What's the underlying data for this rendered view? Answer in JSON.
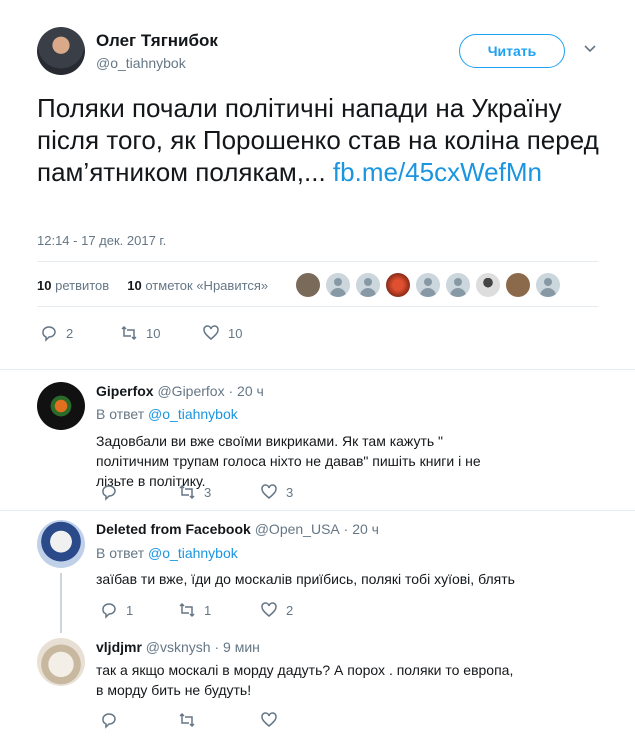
{
  "main_tweet": {
    "author_name": "Олег Тягнибок",
    "author_handle": "@o_tiahnybok",
    "follow_label": "Читать",
    "text": "Поляки почали політичні напади на Україну після того, як Порошенко став на коліна перед пам’ятником полякам,...",
    "link_text": "fb.me/45cxWefMn",
    "timestamp": "12:14 - 17 дек. 2017 г.",
    "retweets_count": "10",
    "retweets_label": "ретвитов",
    "likes_count": "10",
    "likes_label": "отметок «Нравится»",
    "reply_count": "2",
    "retweet_count_action": "10",
    "like_count_action": "10"
  },
  "replies": [
    {
      "name": "Giperfox",
      "handle": "@Giperfox",
      "time": "· 20 ч",
      "in_reply_label": "В ответ",
      "in_reply_to": "@o_tiahnybok",
      "text": "Задовбали ви вже своїми викриками. Як там кажуть \" політичним трупам голоса ніхто не давав\" пишіть книги і не лізьте в політику.",
      "reply_count": "",
      "retweet_count": "3",
      "like_count": "3"
    },
    {
      "name": "Deleted from Facebook",
      "handle": "@Open_USA",
      "time": "· 20 ч",
      "in_reply_label": "В ответ",
      "in_reply_to": "@o_tiahnybok",
      "text": "заїбав ти вже, їди до москалів приїбись, полякі тобі хуїові, блять",
      "reply_count": "1",
      "retweet_count": "1",
      "like_count": "2"
    },
    {
      "name": "vljdjmr",
      "handle": "@vsknysh",
      "time": "· 9 мин",
      "text": "так а якщо москалі в морду дадуть? А порох . поляки то  европа,  в морду бить не будуть!",
      "reply_count": "",
      "retweet_count": "",
      "like_count": ""
    }
  ],
  "colors": {
    "accent": "#1da1f2",
    "link": "#1b95e0",
    "muted": "#657786",
    "divider": "#e6ecf0"
  }
}
